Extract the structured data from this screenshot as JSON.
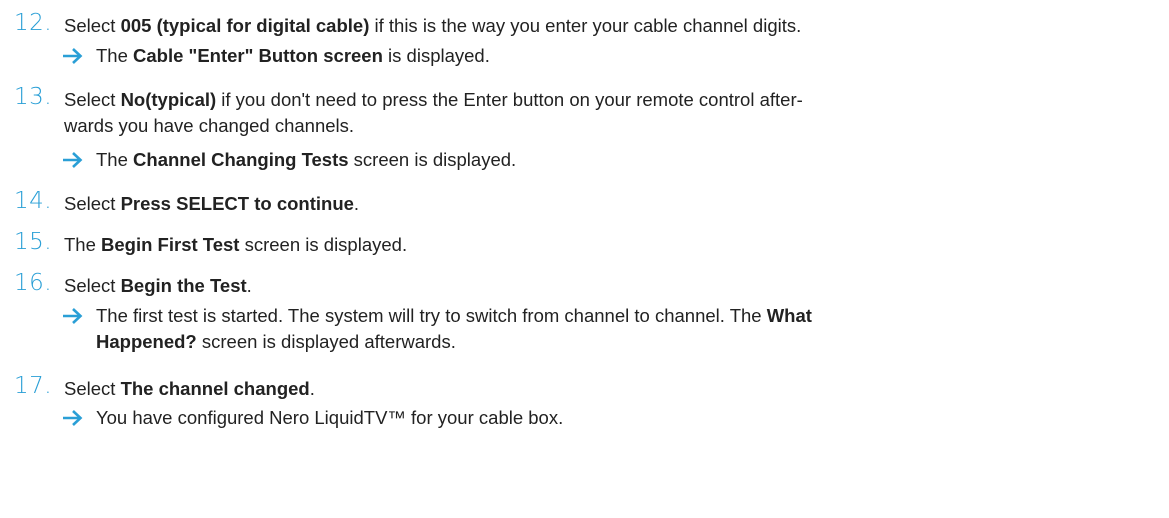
{
  "steps": [
    {
      "number": "12.",
      "pre": "Select ",
      "bold": "005 (typical for digital cable)",
      "post": " if this is the way you enter your cable channel digits.",
      "result": {
        "pre": "The ",
        "bold": "Cable \"Enter\" Button screen",
        "post": " is displayed."
      }
    },
    {
      "number": "13.",
      "pre": "Select ",
      "bold": "No(typical)",
      "post_line1": " if you don't need to press the Enter button on your remote control after-",
      "post_line2": "wards you have changed channels.",
      "result": {
        "pre": "The ",
        "bold": "Channel Changing Tests",
        "post": " screen is displayed."
      }
    },
    {
      "number": "14.",
      "pre": "Select ",
      "bold": "Press SELECT to continue",
      "post": "."
    },
    {
      "number": "15.",
      "pre": "The ",
      "bold": "Begin First Test",
      "post": " screen is displayed."
    },
    {
      "number": "16.",
      "pre": "Select ",
      "bold": "Begin the Test",
      "post": ".",
      "result": {
        "line1_pre": "The first test is started. The system will try to switch from channel to channel. The ",
        "line1_bold": "What",
        "line2_bold": "Happened?",
        "line2_post": " screen is displayed afterwards."
      }
    },
    {
      "number": "17.",
      "pre": "Select ",
      "bold": "The channel changed",
      "post": ".",
      "result": {
        "text": "You have configured Nero LiquidTV™ for your cable box."
      }
    }
  ],
  "colors": {
    "accent": "#2a9fd6",
    "text": "#222222"
  },
  "icons": {
    "result_marker": "right-arrow-icon"
  }
}
